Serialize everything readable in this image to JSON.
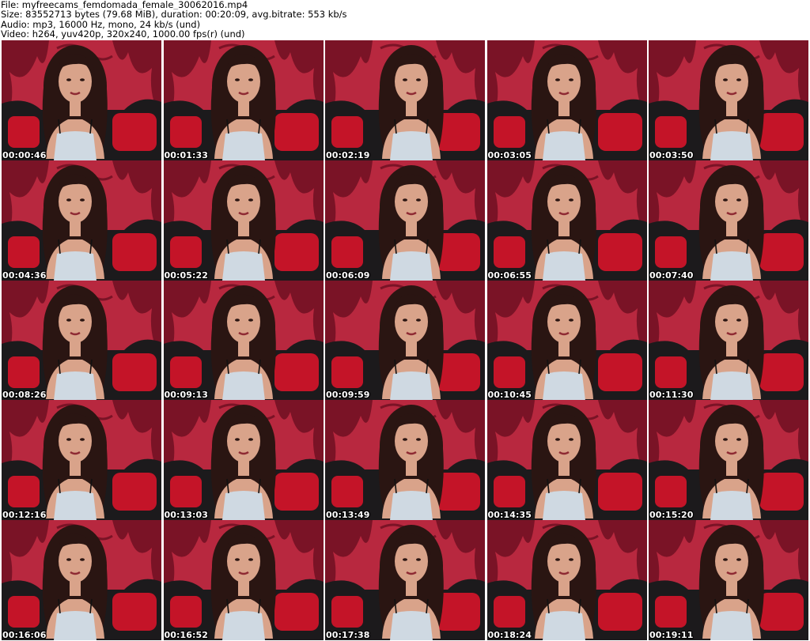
{
  "header": {
    "file_line": "File: myfreecams_femdomada_female_30062016.mp4",
    "size_line": "Size: 83552713 bytes (79.68 MiB), duration: 00:20:09, avg.bitrate: 553 kb/s",
    "audio_line": "Audio: mp3, 16000 Hz, mono, 24 kb/s (und)",
    "video_line": "Video: h264, yuv420p, 320x240, 1000.00 fps(r) (und)"
  },
  "colors": {
    "background_red": "#b8283f",
    "curtain_dark": "#7a1326",
    "sofa_black": "#1c1a1c",
    "cushion_red": "#c41428",
    "skin": "#d9a38a",
    "hair": "#2a1512",
    "dress": "#cfd9e2"
  },
  "thumbnails": [
    {
      "timestamp": "00:00:46"
    },
    {
      "timestamp": "00:01:33"
    },
    {
      "timestamp": "00:02:19"
    },
    {
      "timestamp": "00:03:05"
    },
    {
      "timestamp": "00:03:50"
    },
    {
      "timestamp": "00:04:36"
    },
    {
      "timestamp": "00:05:22"
    },
    {
      "timestamp": "00:06:09"
    },
    {
      "timestamp": "00:06:55"
    },
    {
      "timestamp": "00:07:40"
    },
    {
      "timestamp": "00:08:26"
    },
    {
      "timestamp": "00:09:13"
    },
    {
      "timestamp": "00:09:59"
    },
    {
      "timestamp": "00:10:45"
    },
    {
      "timestamp": "00:11:30"
    },
    {
      "timestamp": "00:12:16"
    },
    {
      "timestamp": "00:13:03"
    },
    {
      "timestamp": "00:13:49"
    },
    {
      "timestamp": "00:14:35"
    },
    {
      "timestamp": "00:15:20"
    },
    {
      "timestamp": "00:16:06"
    },
    {
      "timestamp": "00:16:52"
    },
    {
      "timestamp": "00:17:38"
    },
    {
      "timestamp": "00:18:24"
    },
    {
      "timestamp": "00:19:11"
    }
  ]
}
